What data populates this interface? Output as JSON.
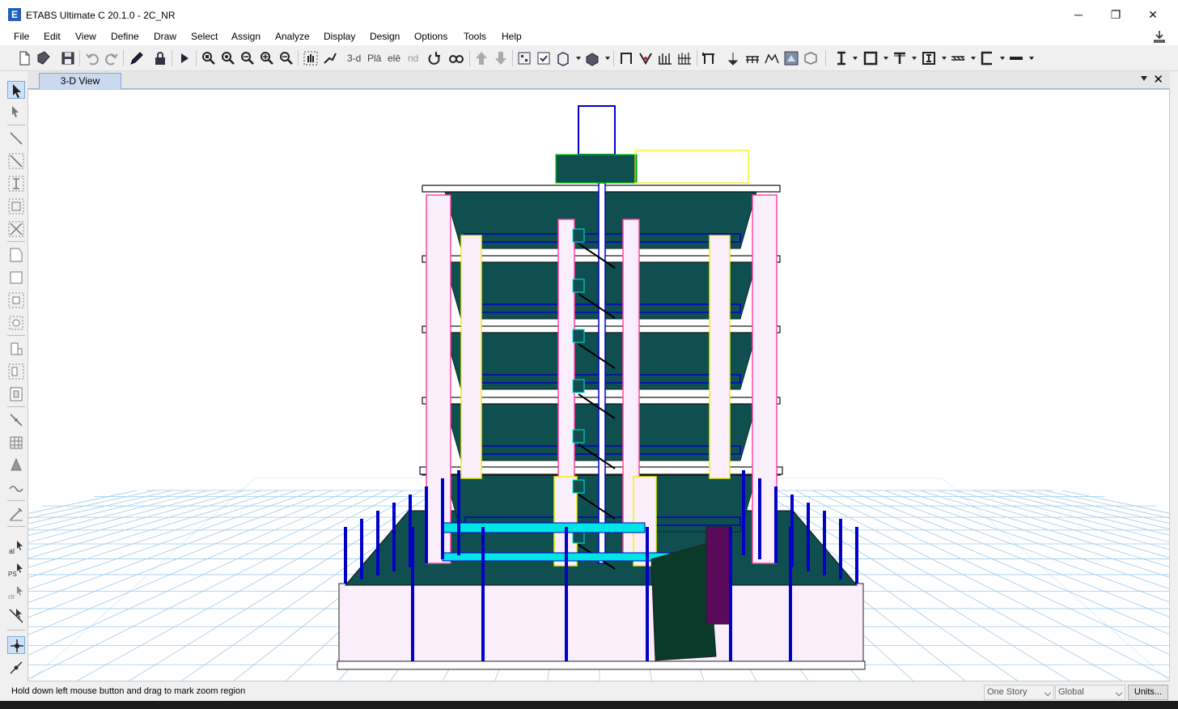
{
  "window": {
    "app_icon_letter": "E",
    "title": "ETABS Ultimate C 20.1.0 - 2C_NR",
    "minimize": "─",
    "restore": "❐",
    "close": "✕"
  },
  "menu": [
    "File",
    "Edit",
    "View",
    "Define",
    "Draw",
    "Select",
    "Assign",
    "Analyze",
    "Display",
    "Design",
    "Options",
    "Tools",
    "Help"
  ],
  "toolbar": {
    "view_3d_label": "3-d",
    "plan_label": "Plā",
    "elev_label": "elē",
    "nd_label": "nd"
  },
  "view": {
    "tab_label": "3-D View",
    "colors": {
      "slab": "#0f4f4f",
      "beam": "#0000c8",
      "column_pink": "#ff3c9b",
      "column_yellow": "#f0f000",
      "wall_fill": "#fbeefb",
      "grid": "#9fcbec",
      "cyan": "#00e5e5"
    }
  },
  "status": {
    "message": "Hold down left mouse button and drag to mark zoom region",
    "story_select": "One Story",
    "coord_select": "Global",
    "units_button": "Units..."
  }
}
